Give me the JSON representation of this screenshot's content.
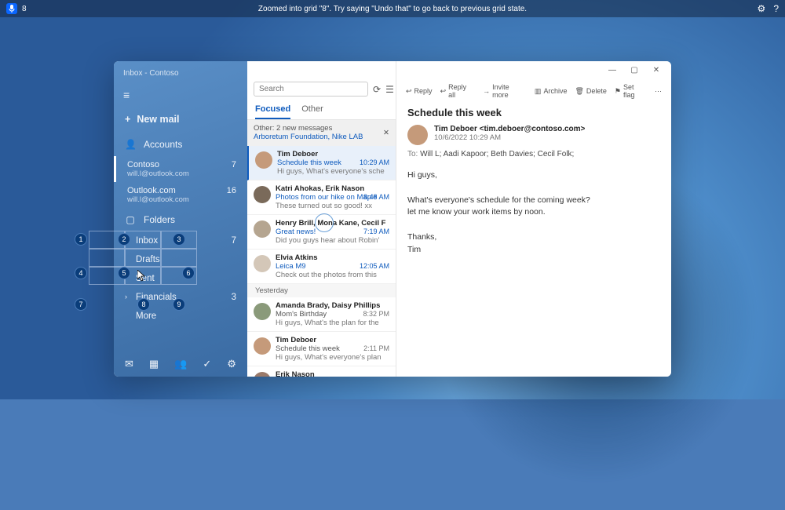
{
  "voice": {
    "badge": "8",
    "hint": "Zoomed into grid \"8\". Try saying \"Undo that\" to go back to previous grid state."
  },
  "window": {
    "min": "—",
    "max": "▢",
    "close": "✕"
  },
  "sidebar": {
    "app_title": "Inbox - Contoso",
    "new_mail": "New mail",
    "accounts_label": "Accounts",
    "accounts": [
      {
        "name": "Contoso",
        "email": "will.l@outlook.com",
        "count": "7"
      },
      {
        "name": "Outlook.com",
        "email": "will.l@outlook.com",
        "count": "16"
      }
    ],
    "folders_label": "Folders",
    "folders": [
      {
        "name": "Inbox",
        "count": "7"
      },
      {
        "name": "Drafts",
        "count": ""
      },
      {
        "name": "Sent",
        "count": ""
      },
      {
        "name": "Financials",
        "count": "3"
      },
      {
        "name": "More",
        "count": ""
      }
    ]
  },
  "list": {
    "search_placeholder": "Search",
    "tabs": {
      "focused": "Focused",
      "other": "Other"
    },
    "other_banner": {
      "title": "Other: 2 new messages",
      "senders": "Arboretum Foundation, Nike LAB"
    },
    "items": [
      {
        "from": "Tim Deboer",
        "subject": "Schedule this week",
        "preview": "Hi guys, What's everyone's sche",
        "time": "10:29 AM"
      },
      {
        "from": "Katri Ahokas, Erik Nason",
        "subject": "Photos from our hike on Maple",
        "preview": "These turned out so good! xx",
        "time": "8:48 AM"
      },
      {
        "from": "Henry Brill, Mona Kane, Cecil F",
        "subject": "Great news!",
        "preview": "Did you guys hear about Robin'",
        "time": "7:19 AM"
      },
      {
        "from": "Elvia Atkins",
        "subject": "Leica M9",
        "preview": "Check out the photos from this",
        "time": "12:05 AM"
      }
    ],
    "yesterday_label": "Yesterday",
    "yesterday": [
      {
        "from": "Amanda Brady, Daisy Phillips",
        "subject": "Mom's Birthday",
        "preview": "Hi guys, What's the plan for the",
        "time": "8:32 PM"
      },
      {
        "from": "Tim Deboer",
        "subject": "Schedule this week",
        "preview": "Hi guys, What's everyone's plan",
        "time": "2:11 PM"
      },
      {
        "from": "Erik Nason",
        "subject": "",
        "preview": "",
        "time": ""
      }
    ]
  },
  "reading": {
    "actions": {
      "reply": "Reply",
      "reply_all": "Reply all",
      "invite": "Invite more",
      "archive": "Archive",
      "delete": "Delete",
      "flag": "Set flag"
    },
    "subject": "Schedule this week",
    "sender_name": "Tim Deboer <tim.deboer@contoso.com>",
    "date": "10/6/2022 10:29 AM",
    "to_label": "To:",
    "to": "Will L; Aadi Kapoor; Beth Davies; Cecil Folk;",
    "body_1": "Hi guys,",
    "body_2": "What's everyone's schedule for the coming week?",
    "body_3": "let me know your work items by noon.",
    "body_4": "Thanks,",
    "body_5": "Tim"
  },
  "grid_numbers": [
    "1",
    "2",
    "3",
    "4",
    "5",
    "6",
    "7",
    "8",
    "9"
  ]
}
